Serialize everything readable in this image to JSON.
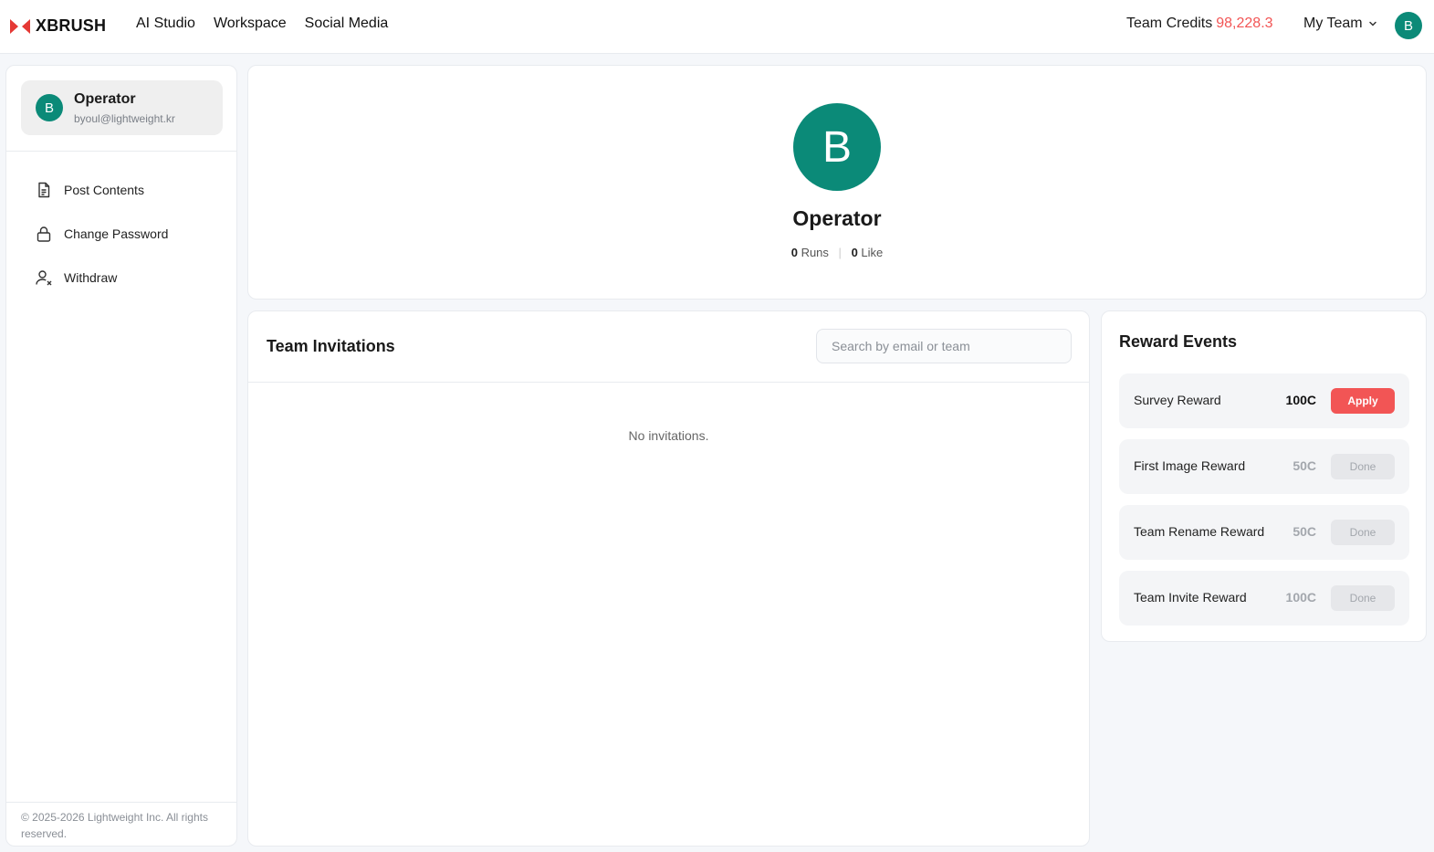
{
  "brand": {
    "name": "XBRUSH"
  },
  "nav": {
    "items": [
      "AI Studio",
      "Workspace",
      "Social Media"
    ]
  },
  "header": {
    "credits_label": "Team Credits",
    "credits_value": "98,228.3",
    "team_label": "My Team",
    "avatar_letter": "B"
  },
  "sidebar": {
    "profile": {
      "letter": "B",
      "name": "Operator",
      "email": "byoul@lightweight.kr"
    },
    "menu": [
      {
        "label": "Post Contents",
        "icon": "document-icon"
      },
      {
        "label": "Change Password",
        "icon": "lock-icon"
      },
      {
        "label": "Withdraw",
        "icon": "user-remove-icon"
      }
    ],
    "footer": "© 2025-2026 Lightweight Inc. All rights reserved."
  },
  "profile": {
    "letter": "B",
    "name": "Operator",
    "runs_count": "0",
    "runs_label": "Runs",
    "likes_count": "0",
    "likes_label": "Like"
  },
  "invitations": {
    "title": "Team Invitations",
    "search_placeholder": "Search by email or team",
    "empty_text": "No invitations."
  },
  "rewards": {
    "title": "Reward Events",
    "items": [
      {
        "label": "Survey Reward",
        "amount": "100C",
        "action": "Apply",
        "status": "active"
      },
      {
        "label": "First Image Reward",
        "amount": "50C",
        "action": "Done",
        "status": "done"
      },
      {
        "label": "Team Rename Reward",
        "amount": "50C",
        "action": "Done",
        "status": "done"
      },
      {
        "label": "Team Invite Reward",
        "amount": "100C",
        "action": "Done",
        "status": "done"
      }
    ]
  },
  "colors": {
    "accent": "#f25555",
    "avatar": "#0b8a78"
  }
}
